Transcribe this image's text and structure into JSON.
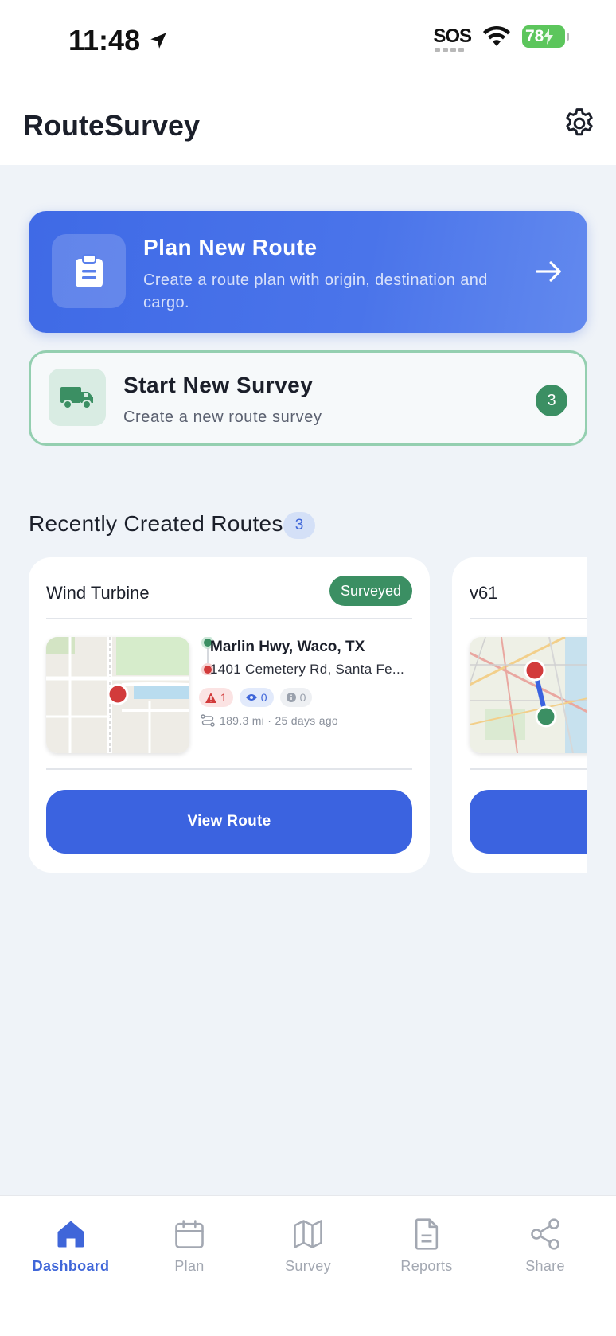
{
  "status_bar": {
    "time": "11:48",
    "sos": "SOS",
    "battery": "78"
  },
  "header": {
    "title": "RouteSurvey"
  },
  "plan_card": {
    "title": "Plan New Route",
    "description": "Create a route plan with origin, destination and cargo.",
    "icon": "clipboard-icon"
  },
  "survey_card": {
    "title": "Start New Survey",
    "description": "Create a new route survey",
    "count": "3",
    "icon": "truck-icon"
  },
  "recent": {
    "title": "Recently Created Routes",
    "count": "3",
    "routes": [
      {
        "name": "Wind Turbine",
        "status": "Surveyed",
        "origin": "Marlin Hwy, Waco, TX",
        "destination": "1401 Cemetery Rd, Santa Fe...",
        "warnings": "1",
        "observations": "0",
        "info": "0",
        "meta": "189.3 mi · 25 days ago",
        "button": "View Route"
      },
      {
        "name": "v61"
      }
    ]
  },
  "nav": {
    "items": [
      {
        "label": "Dashboard",
        "icon": "home-icon",
        "active": true
      },
      {
        "label": "Plan",
        "icon": "calendar-icon"
      },
      {
        "label": "Survey",
        "icon": "map-icon"
      },
      {
        "label": "Reports",
        "icon": "document-icon"
      },
      {
        "label": "Share",
        "icon": "share-icon"
      }
    ]
  },
  "colors": {
    "primary": "#3b63e0",
    "success": "#3b8f63",
    "danger": "#d23b3b",
    "background": "#eff3f8"
  }
}
